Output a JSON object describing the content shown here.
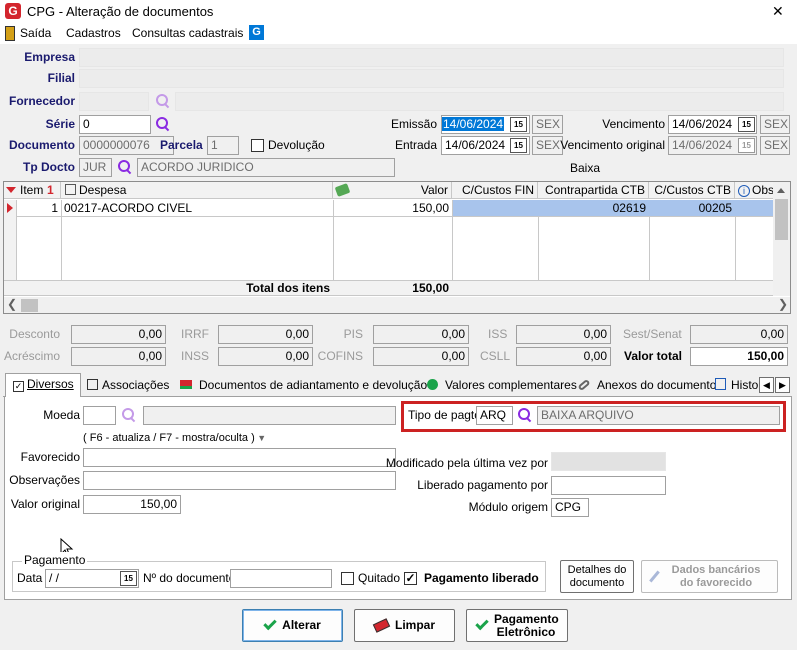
{
  "window": {
    "title": "CPG - Alteração de documentos",
    "close": "✕"
  },
  "menu": [
    "Saída",
    "Cadastros",
    "Consultas cadastrais"
  ],
  "header": {
    "empresa_label": "Empresa",
    "filial_label": "Filial",
    "fornecedor_label": "Fornecedor",
    "empresa_value": "",
    "filial_value": "",
    "fornecedor_code": "",
    "fornecedor_name": "",
    "serie_label": "Série",
    "serie_value": "0",
    "documento_label": "Documento",
    "documento_value": "0000000076",
    "parcela_label": "Parcela",
    "parcela_value": "1",
    "devolucao_label": "Devolução",
    "tpdocto_label": "Tp Docto",
    "tpdocto_code": "JUR",
    "tpdocto_desc": "ACORDO JURIDICO",
    "emissao_label": "Emissão",
    "emissao_value": "14/06/2024",
    "emissao_day": "SEX",
    "entrada_label": "Entrada",
    "entrada_value": "14/06/2024",
    "entrada_day": "SEX",
    "vencimento_label": "Vencimento",
    "vencimento_value": "14/06/2024",
    "vencimento_day": "SEX",
    "venc_original_label": "Vencimento original",
    "venc_original_value": "14/06/2024",
    "venc_original_day": "SEX",
    "baixa_label": "Baixa",
    "cal_glyph": "15"
  },
  "grid": {
    "headers": [
      "Item",
      "Despesa",
      "Valor",
      "C/Custos FIN",
      "Contrapartida CTB",
      "C/Custos CTB",
      "Obs"
    ],
    "sort_indicator": "1",
    "rows": [
      {
        "item": "1",
        "despesa": "00217-ACORDO CIVEL",
        "valor": "150,00",
        "ccfin": "",
        "contrapartida": "02619",
        "ccctb": "00205",
        "obs": ""
      }
    ],
    "total_label": "Total dos itens",
    "total_value": "150,00"
  },
  "totals": {
    "desconto_label": "Desconto",
    "desconto": "0,00",
    "irrf_label": "IRRF",
    "irrf": "0,00",
    "pis_label": "PIS",
    "pis": "0,00",
    "iss_label": "ISS",
    "iss": "0,00",
    "sest_label": "Sest/Senat",
    "sest": "0,00",
    "acrescimo_label": "Acréscimo",
    "acrescimo": "0,00",
    "inss_label": "INSS",
    "inss": "0,00",
    "cofins_label": "COFINS",
    "cofins": "0,00",
    "csll_label": "CSLL",
    "csll": "0,00",
    "valortotal_label": "Valor total",
    "valortotal": "150,00"
  },
  "tabs": [
    "Diversos",
    "Associações",
    "Documentos de adiantamento e devolução",
    "Valores complementares",
    "Anexos do documento",
    "Histo"
  ],
  "diversos": {
    "moeda_label": "Moeda",
    "moeda_value": "",
    "moeda_desc": "",
    "hint": "( F6 - atualiza / F7 - mostra/oculta )",
    "favorecido_label": "Favorecido",
    "favorecido_value": "",
    "observacoes_label": "Observações",
    "observacoes_value": "",
    "valororiginal_label": "Valor original",
    "valororiginal_value": "150,00",
    "tipopagto_label": "Tipo de pagto",
    "tipopagto_code": "ARQ",
    "tipopagto_desc": "BAIXA ARQUIVO",
    "modificado_label": "Modificado pela última vez por",
    "modificado_value": "",
    "liberado_label": "Liberado pagamento por",
    "liberado_value": "",
    "modulo_label": "Módulo origem",
    "modulo_value": "CPG"
  },
  "pagamento": {
    "group_label": "Pagamento",
    "data_label": "Data",
    "data_value": " /  /",
    "ndoc_label": "Nº do documento",
    "ndoc_value": "",
    "quitado_label": "Quitado",
    "liberado_label": "Pagamento liberado",
    "detalhes_label": "Detalhes do documento",
    "dados_label": "Dados bancários do favorecido"
  },
  "buttons": {
    "alterar": "Alterar",
    "limpar": "Limpar",
    "pagamento": "Pagamento Eletrônico"
  },
  "colors": {
    "accent": "#0078d7",
    "brand": "#d3262e",
    "highlight": "#cc2222",
    "selected_row": "#a8c4ec"
  }
}
